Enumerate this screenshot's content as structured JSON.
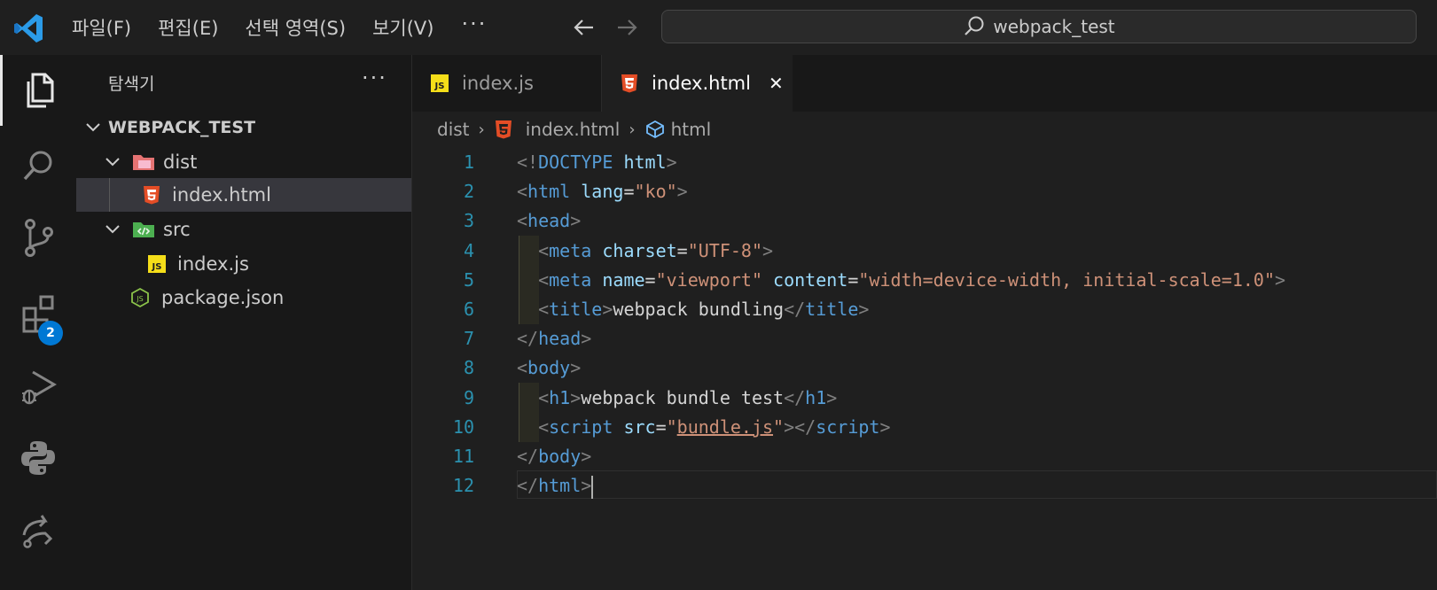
{
  "app": {
    "menu": [
      "파일(F)",
      "편집(E)",
      "선택 영역(S)",
      "보기(V)"
    ],
    "menu_more": "···",
    "search_text": "webpack_test"
  },
  "activity": {
    "extensions_badge": "2"
  },
  "explorer": {
    "title": "탐색기",
    "more": "···",
    "root": "WEBPACK_TEST",
    "items": [
      {
        "label": "dist",
        "kind": "folder",
        "expanded": true
      },
      {
        "label": "index.html",
        "kind": "html",
        "selected": true
      },
      {
        "label": "src",
        "kind": "folder",
        "expanded": true
      },
      {
        "label": "index.js",
        "kind": "js"
      },
      {
        "label": "package.json",
        "kind": "json"
      }
    ]
  },
  "tabs": [
    {
      "label": "index.js",
      "icon": "js-file-icon",
      "active": false
    },
    {
      "label": "index.html",
      "icon": "html-file-icon",
      "active": true,
      "close": "✕"
    }
  ],
  "breadcrumb": {
    "folder": "dist",
    "file": "index.html",
    "symbol": "html"
  },
  "editor": {
    "line_numbers": [
      "1",
      "2",
      "3",
      "4",
      "5",
      "6",
      "7",
      "8",
      "9",
      "10",
      "11",
      "12"
    ],
    "lines": [
      [
        [
          "p",
          "<!"
        ],
        [
          "t",
          "DOCTYPE"
        ],
        [
          "x",
          " "
        ],
        [
          "a",
          "html"
        ],
        [
          "p",
          ">"
        ]
      ],
      [
        [
          "p",
          "<"
        ],
        [
          "t",
          "html"
        ],
        [
          "x",
          " "
        ],
        [
          "a",
          "lang"
        ],
        [
          "x",
          "="
        ],
        [
          "s",
          "\"ko\""
        ],
        [
          "p",
          ">"
        ]
      ],
      [
        [
          "p",
          "<"
        ],
        [
          "t",
          "head"
        ],
        [
          "p",
          ">"
        ]
      ],
      [
        [
          "x",
          "  "
        ],
        [
          "p",
          "<"
        ],
        [
          "t",
          "meta"
        ],
        [
          "x",
          " "
        ],
        [
          "a",
          "charset"
        ],
        [
          "x",
          "="
        ],
        [
          "s",
          "\"UTF-8\""
        ],
        [
          "p",
          ">"
        ]
      ],
      [
        [
          "x",
          "  "
        ],
        [
          "p",
          "<"
        ],
        [
          "t",
          "meta"
        ],
        [
          "x",
          " "
        ],
        [
          "a",
          "name"
        ],
        [
          "x",
          "="
        ],
        [
          "s",
          "\"viewport\""
        ],
        [
          "x",
          " "
        ],
        [
          "a",
          "content"
        ],
        [
          "x",
          "="
        ],
        [
          "s",
          "\"width=device-width, initial-scale=1.0\""
        ],
        [
          "p",
          ">"
        ]
      ],
      [
        [
          "x",
          "  "
        ],
        [
          "p",
          "<"
        ],
        [
          "t",
          "title"
        ],
        [
          "p",
          ">"
        ],
        [
          "x",
          "webpack bundling"
        ],
        [
          "p",
          "</"
        ],
        [
          "t",
          "title"
        ],
        [
          "p",
          ">"
        ]
      ],
      [
        [
          "p",
          "</"
        ],
        [
          "t",
          "head"
        ],
        [
          "p",
          ">"
        ]
      ],
      [
        [
          "p",
          "<"
        ],
        [
          "t",
          "body"
        ],
        [
          "p",
          ">"
        ]
      ],
      [
        [
          "x",
          "  "
        ],
        [
          "p",
          "<"
        ],
        [
          "t",
          "h1"
        ],
        [
          "p",
          ">"
        ],
        [
          "x",
          "webpack bundle test"
        ],
        [
          "p",
          "</"
        ],
        [
          "t",
          "h1"
        ],
        [
          "p",
          ">"
        ]
      ],
      [
        [
          "x",
          "  "
        ],
        [
          "p",
          "<"
        ],
        [
          "t",
          "script"
        ],
        [
          "x",
          " "
        ],
        [
          "a",
          "src"
        ],
        [
          "x",
          "="
        ],
        [
          "s",
          "\""
        ],
        [
          "su",
          "bundle.js"
        ],
        [
          "s",
          "\""
        ],
        [
          "p",
          ">"
        ],
        [
          "p",
          "</"
        ],
        [
          "t",
          "script"
        ],
        [
          "p",
          ">"
        ]
      ],
      [
        [
          "p",
          "</"
        ],
        [
          "t",
          "body"
        ],
        [
          "p",
          ">"
        ]
      ],
      [
        [
          "p",
          "</"
        ],
        [
          "t",
          "html"
        ],
        [
          "p",
          ">"
        ]
      ]
    ],
    "current_line": 12
  }
}
